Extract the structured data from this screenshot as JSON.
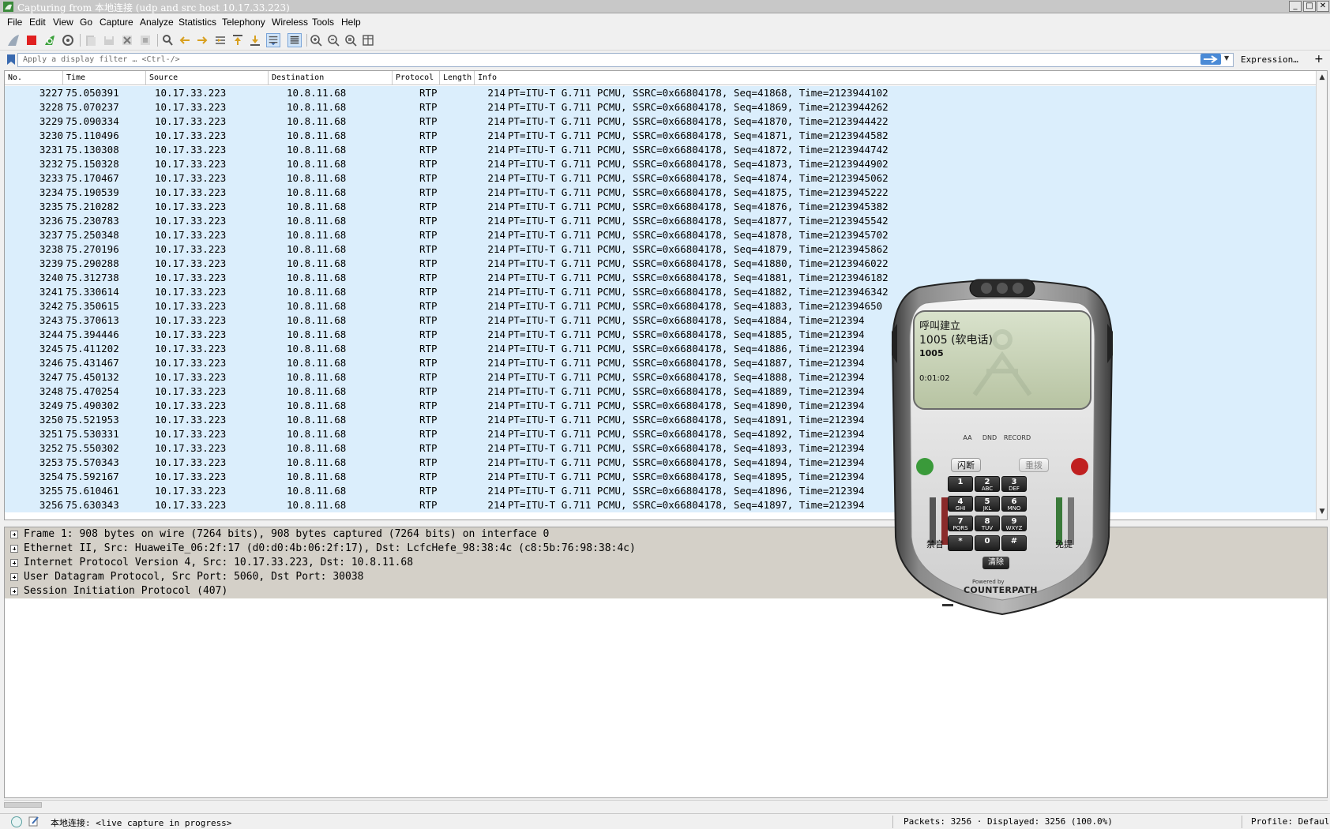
{
  "window": {
    "title": "Capturing from 本地连接 (udp and src host 10.17.33.223)",
    "controls": [
      "_",
      "□",
      "✕"
    ]
  },
  "menu": [
    "File",
    "Edit",
    "View",
    "Go",
    "Capture",
    "Analyze",
    "Statistics",
    "Telephony",
    "Wireless",
    "Tools",
    "Help"
  ],
  "toolbar_icons": [
    "shark-fin-start-icon",
    "stop-capture-icon",
    "restart-capture-icon",
    "capture-options-icon",
    "open-file-icon",
    "save-file-icon",
    "close-file-icon",
    "reload-file-icon",
    "find-packet-icon",
    "go-back-icon",
    "go-forward-icon",
    "go-to-packet-icon",
    "go-first-icon",
    "go-last-icon",
    "autoscroll-icon",
    "colorize-icon",
    "zoom-in-icon",
    "zoom-out-icon",
    "zoom-normal-icon",
    "resize-columns-icon"
  ],
  "filter": {
    "placeholder": "Apply a display filter … <Ctrl-/>",
    "expression_label": "Expression…",
    "add_label": "+"
  },
  "packet_list": {
    "columns": [
      "No.",
      "Time",
      "Source",
      "Destination",
      "Protocol",
      "Length",
      "Info"
    ],
    "rows": [
      {
        "no": "3227",
        "time": "75.050391",
        "src": "10.17.33.223",
        "dst": "10.8.11.68",
        "proto": "RTP",
        "len": "214",
        "info": "PT=ITU-T G.711 PCMU, SSRC=0x66804178, Seq=41868, Time=2123944102"
      },
      {
        "no": "3228",
        "time": "75.070237",
        "src": "10.17.33.223",
        "dst": "10.8.11.68",
        "proto": "RTP",
        "len": "214",
        "info": "PT=ITU-T G.711 PCMU, SSRC=0x66804178, Seq=41869, Time=2123944262"
      },
      {
        "no": "3229",
        "time": "75.090334",
        "src": "10.17.33.223",
        "dst": "10.8.11.68",
        "proto": "RTP",
        "len": "214",
        "info": "PT=ITU-T G.711 PCMU, SSRC=0x66804178, Seq=41870, Time=2123944422"
      },
      {
        "no": "3230",
        "time": "75.110496",
        "src": "10.17.33.223",
        "dst": "10.8.11.68",
        "proto": "RTP",
        "len": "214",
        "info": "PT=ITU-T G.711 PCMU, SSRC=0x66804178, Seq=41871, Time=2123944582"
      },
      {
        "no": "3231",
        "time": "75.130308",
        "src": "10.17.33.223",
        "dst": "10.8.11.68",
        "proto": "RTP",
        "len": "214",
        "info": "PT=ITU-T G.711 PCMU, SSRC=0x66804178, Seq=41872, Time=2123944742"
      },
      {
        "no": "3232",
        "time": "75.150328",
        "src": "10.17.33.223",
        "dst": "10.8.11.68",
        "proto": "RTP",
        "len": "214",
        "info": "PT=ITU-T G.711 PCMU, SSRC=0x66804178, Seq=41873, Time=2123944902"
      },
      {
        "no": "3233",
        "time": "75.170467",
        "src": "10.17.33.223",
        "dst": "10.8.11.68",
        "proto": "RTP",
        "len": "214",
        "info": "PT=ITU-T G.711 PCMU, SSRC=0x66804178, Seq=41874, Time=2123945062"
      },
      {
        "no": "3234",
        "time": "75.190539",
        "src": "10.17.33.223",
        "dst": "10.8.11.68",
        "proto": "RTP",
        "len": "214",
        "info": "PT=ITU-T G.711 PCMU, SSRC=0x66804178, Seq=41875, Time=2123945222"
      },
      {
        "no": "3235",
        "time": "75.210282",
        "src": "10.17.33.223",
        "dst": "10.8.11.68",
        "proto": "RTP",
        "len": "214",
        "info": "PT=ITU-T G.711 PCMU, SSRC=0x66804178, Seq=41876, Time=2123945382"
      },
      {
        "no": "3236",
        "time": "75.230783",
        "src": "10.17.33.223",
        "dst": "10.8.11.68",
        "proto": "RTP",
        "len": "214",
        "info": "PT=ITU-T G.711 PCMU, SSRC=0x66804178, Seq=41877, Time=2123945542"
      },
      {
        "no": "3237",
        "time": "75.250348",
        "src": "10.17.33.223",
        "dst": "10.8.11.68",
        "proto": "RTP",
        "len": "214",
        "info": "PT=ITU-T G.711 PCMU, SSRC=0x66804178, Seq=41878, Time=2123945702"
      },
      {
        "no": "3238",
        "time": "75.270196",
        "src": "10.17.33.223",
        "dst": "10.8.11.68",
        "proto": "RTP",
        "len": "214",
        "info": "PT=ITU-T G.711 PCMU, SSRC=0x66804178, Seq=41879, Time=2123945862"
      },
      {
        "no": "3239",
        "time": "75.290288",
        "src": "10.17.33.223",
        "dst": "10.8.11.68",
        "proto": "RTP",
        "len": "214",
        "info": "PT=ITU-T G.711 PCMU, SSRC=0x66804178, Seq=41880, Time=2123946022"
      },
      {
        "no": "3240",
        "time": "75.312738",
        "src": "10.17.33.223",
        "dst": "10.8.11.68",
        "proto": "RTP",
        "len": "214",
        "info": "PT=ITU-T G.711 PCMU, SSRC=0x66804178, Seq=41881, Time=2123946182"
      },
      {
        "no": "3241",
        "time": "75.330614",
        "src": "10.17.33.223",
        "dst": "10.8.11.68",
        "proto": "RTP",
        "len": "214",
        "info": "PT=ITU-T G.711 PCMU, SSRC=0x66804178, Seq=41882, Time=2123946342"
      },
      {
        "no": "3242",
        "time": "75.350615",
        "src": "10.17.33.223",
        "dst": "10.8.11.68",
        "proto": "RTP",
        "len": "214",
        "info": "PT=ITU-T G.711 PCMU, SSRC=0x66804178, Seq=41883, Time=212394650"
      },
      {
        "no": "3243",
        "time": "75.370613",
        "src": "10.17.33.223",
        "dst": "10.8.11.68",
        "proto": "RTP",
        "len": "214",
        "info": "PT=ITU-T G.711 PCMU, SSRC=0x66804178, Seq=41884, Time=212394"
      },
      {
        "no": "3244",
        "time": "75.394446",
        "src": "10.17.33.223",
        "dst": "10.8.11.68",
        "proto": "RTP",
        "len": "214",
        "info": "PT=ITU-T G.711 PCMU, SSRC=0x66804178, Seq=41885, Time=212394"
      },
      {
        "no": "3245",
        "time": "75.411202",
        "src": "10.17.33.223",
        "dst": "10.8.11.68",
        "proto": "RTP",
        "len": "214",
        "info": "PT=ITU-T G.711 PCMU, SSRC=0x66804178, Seq=41886, Time=212394"
      },
      {
        "no": "3246",
        "time": "75.431467",
        "src": "10.17.33.223",
        "dst": "10.8.11.68",
        "proto": "RTP",
        "len": "214",
        "info": "PT=ITU-T G.711 PCMU, SSRC=0x66804178, Seq=41887, Time=212394"
      },
      {
        "no": "3247",
        "time": "75.450132",
        "src": "10.17.33.223",
        "dst": "10.8.11.68",
        "proto": "RTP",
        "len": "214",
        "info": "PT=ITU-T G.711 PCMU, SSRC=0x66804178, Seq=41888, Time=212394"
      },
      {
        "no": "3248",
        "time": "75.470254",
        "src": "10.17.33.223",
        "dst": "10.8.11.68",
        "proto": "RTP",
        "len": "214",
        "info": "PT=ITU-T G.711 PCMU, SSRC=0x66804178, Seq=41889, Time=212394"
      },
      {
        "no": "3249",
        "time": "75.490302",
        "src": "10.17.33.223",
        "dst": "10.8.11.68",
        "proto": "RTP",
        "len": "214",
        "info": "PT=ITU-T G.711 PCMU, SSRC=0x66804178, Seq=41890, Time=212394"
      },
      {
        "no": "3250",
        "time": "75.521953",
        "src": "10.17.33.223",
        "dst": "10.8.11.68",
        "proto": "RTP",
        "len": "214",
        "info": "PT=ITU-T G.711 PCMU, SSRC=0x66804178, Seq=41891, Time=212394"
      },
      {
        "no": "3251",
        "time": "75.530331",
        "src": "10.17.33.223",
        "dst": "10.8.11.68",
        "proto": "RTP",
        "len": "214",
        "info": "PT=ITU-T G.711 PCMU, SSRC=0x66804178, Seq=41892, Time=212394"
      },
      {
        "no": "3252",
        "time": "75.550302",
        "src": "10.17.33.223",
        "dst": "10.8.11.68",
        "proto": "RTP",
        "len": "214",
        "info": "PT=ITU-T G.711 PCMU, SSRC=0x66804178, Seq=41893, Time=212394"
      },
      {
        "no": "3253",
        "time": "75.570343",
        "src": "10.17.33.223",
        "dst": "10.8.11.68",
        "proto": "RTP",
        "len": "214",
        "info": "PT=ITU-T G.711 PCMU, SSRC=0x66804178, Seq=41894, Time=212394"
      },
      {
        "no": "3254",
        "time": "75.592167",
        "src": "10.17.33.223",
        "dst": "10.8.11.68",
        "proto": "RTP",
        "len": "214",
        "info": "PT=ITU-T G.711 PCMU, SSRC=0x66804178, Seq=41895, Time=212394"
      },
      {
        "no": "3255",
        "time": "75.610461",
        "src": "10.17.33.223",
        "dst": "10.8.11.68",
        "proto": "RTP",
        "len": "214",
        "info": "PT=ITU-T G.711 PCMU, SSRC=0x66804178, Seq=41896, Time=212394"
      },
      {
        "no": "3256",
        "time": "75.630343",
        "src": "10.17.33.223",
        "dst": "10.8.11.68",
        "proto": "RTP",
        "len": "214",
        "info": "PT=ITU-T G.711 PCMU, SSRC=0x66804178, Seq=41897, Time=212394"
      }
    ]
  },
  "details": [
    "Frame 1: 908 bytes on wire (7264 bits), 908 bytes captured (7264 bits) on interface 0",
    "Ethernet II, Src: HuaweiTe_06:2f:17 (d0:d0:4b:06:2f:17), Dst: LcfcHefe_98:38:4c (c8:5b:76:98:38:4c)",
    "Internet Protocol Version 4, Src: 10.17.33.223, Dst: 10.8.11.68",
    "User Datagram Protocol, Src Port: 5060, Dst Port: 30038",
    "Session Initiation Protocol (407)"
  ],
  "statusbar": {
    "status": "本地连接: <live capture in progress>",
    "packets": "Packets: 3256 · Displayed: 3256 (100.0%)",
    "profile": "Profile: Default"
  },
  "softphone": {
    "call_status": "呼叫建立",
    "line_label": "1005 (软电话)",
    "number": "1005",
    "timer": "0:01:02",
    "small_buttons": [
      "AA",
      "DND",
      "RECORD"
    ],
    "flash_label": "闪断",
    "redial_label": "重拨",
    "mute_label": "禁音",
    "speaker_label": "免提",
    "clear_label": "清除",
    "keys": [
      {
        "d": "1",
        "l": ""
      },
      {
        "d": "2",
        "l": "ABC"
      },
      {
        "d": "3",
        "l": "DEF"
      },
      {
        "d": "4",
        "l": "GHI"
      },
      {
        "d": "5",
        "l": "JKL"
      },
      {
        "d": "6",
        "l": "MNO"
      },
      {
        "d": "7",
        "l": "PQRS"
      },
      {
        "d": "8",
        "l": "TUV"
      },
      {
        "d": "9",
        "l": "WXYZ"
      },
      {
        "d": "*",
        "l": ""
      },
      {
        "d": "0",
        "l": ""
      },
      {
        "d": "#",
        "l": ""
      }
    ],
    "powered_by": "Powered by",
    "brand": "COUNTERPATH"
  },
  "colors": {
    "row_bg": "#dbeefc",
    "detail_bg": "#d4d0c8",
    "stop_red": "#e02020",
    "lcd_green": "#c9d4b8"
  }
}
